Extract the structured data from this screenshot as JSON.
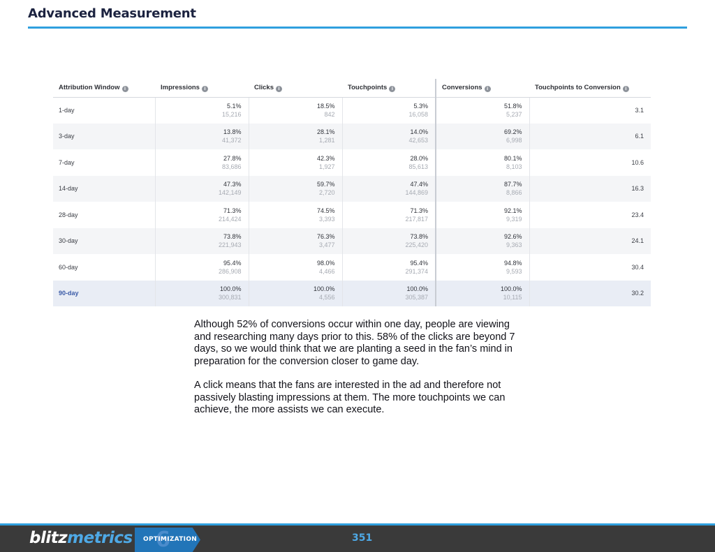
{
  "header": {
    "title": "Advanced Measurement"
  },
  "table": {
    "columns": [
      "Attribution Window",
      "Impressions",
      "Clicks",
      "Touchpoints",
      "Conversions",
      "Touchpoints to Conversion"
    ],
    "rows": [
      {
        "window": "1-day",
        "impressions_pct": "5.1%",
        "impressions": "15,216",
        "clicks_pct": "18.5%",
        "clicks": "842",
        "touch_pct": "5.3%",
        "touch": "16,058",
        "conv_pct": "51.8%",
        "conv": "5,237",
        "ratio": "3.1"
      },
      {
        "window": "3-day",
        "impressions_pct": "13.8%",
        "impressions": "41,372",
        "clicks_pct": "28.1%",
        "clicks": "1,281",
        "touch_pct": "14.0%",
        "touch": "42,653",
        "conv_pct": "69.2%",
        "conv": "6,998",
        "ratio": "6.1"
      },
      {
        "window": "7-day",
        "impressions_pct": "27.8%",
        "impressions": "83,686",
        "clicks_pct": "42.3%",
        "clicks": "1,927",
        "touch_pct": "28.0%",
        "touch": "85,613",
        "conv_pct": "80.1%",
        "conv": "8,103",
        "ratio": "10.6"
      },
      {
        "window": "14-day",
        "impressions_pct": "47.3%",
        "impressions": "142,149",
        "clicks_pct": "59.7%",
        "clicks": "2,720",
        "touch_pct": "47.4%",
        "touch": "144,869",
        "conv_pct": "87.7%",
        "conv": "8,866",
        "ratio": "16.3"
      },
      {
        "window": "28-day",
        "impressions_pct": "71.3%",
        "impressions": "214,424",
        "clicks_pct": "74.5%",
        "clicks": "3,393",
        "touch_pct": "71.3%",
        "touch": "217,817",
        "conv_pct": "92.1%",
        "conv": "9,319",
        "ratio": "23.4"
      },
      {
        "window": "30-day",
        "impressions_pct": "73.8%",
        "impressions": "221,943",
        "clicks_pct": "76.3%",
        "clicks": "3,477",
        "touch_pct": "73.8%",
        "touch": "225,420",
        "conv_pct": "92.6%",
        "conv": "9,363",
        "ratio": "24.1"
      },
      {
        "window": "60-day",
        "impressions_pct": "95.4%",
        "impressions": "286,908",
        "clicks_pct": "98.0%",
        "clicks": "4,466",
        "touch_pct": "95.4%",
        "touch": "291,374",
        "conv_pct": "94.8%",
        "conv": "9,593",
        "ratio": "30.4"
      },
      {
        "window": "90-day",
        "impressions_pct": "100.0%",
        "impressions": "300,831",
        "clicks_pct": "100.0%",
        "clicks": "4,556",
        "touch_pct": "100.0%",
        "touch": "305,387",
        "conv_pct": "100.0%",
        "conv": "10,115",
        "ratio": "30.2"
      }
    ]
  },
  "body": {
    "paragraph1": "Although 52% of conversions occur within one day, people are viewing and researching many days prior to this. 58% of the clicks are beyond 7 days, so we would think that we are planting a seed in the fan’s mind in preparation for the conversion closer to game day.",
    "paragraph2": "A click means that the fans are interested in the ad and therefore not passively blasting impressions at them. The more touchpoints we can achieve, the more assists we can execute."
  },
  "footer": {
    "logo_part1": "blitz",
    "logo_part2": "metrics",
    "badge_number": "6",
    "badge_label": "OPTIMIZATION",
    "page_number": "351"
  },
  "colors": {
    "accent": "#2f9fde",
    "title": "#1c2340",
    "footer_bg": "#3a3a3a",
    "badge": "#2275b8",
    "highlight_row_text": "#3c5ca8"
  },
  "icons": {
    "column_info": "info-icon"
  }
}
